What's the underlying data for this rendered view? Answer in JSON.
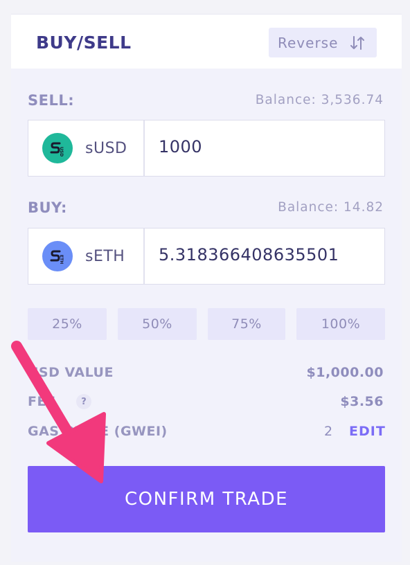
{
  "header": {
    "title": "BUY/SELL",
    "reverse_label": "Reverse"
  },
  "sell": {
    "label": "SELL:",
    "balance": "Balance: 3,536.74",
    "token": "sUSD",
    "token_icon": "susd-coin-icon",
    "amount": "1000"
  },
  "buy": {
    "label": "BUY:",
    "balance": "Balance: 14.82",
    "token": "sETH",
    "token_icon": "seth-coin-icon",
    "amount": "5.318366408635501"
  },
  "percent_buttons": [
    "25%",
    "50%",
    "75%",
    "100%"
  ],
  "info": {
    "usd_value_label": "USD VALUE",
    "usd_value": "$1,000.00",
    "fee_label": "FEE",
    "fee_help": "?",
    "fee_value": "$3.56",
    "gas_label": "GAS PRICE (GWEI)",
    "gas_value": "2",
    "gas_edit": "EDIT"
  },
  "confirm_label": "CONFIRM TRADE",
  "colors": {
    "accent": "#7b5bf5",
    "title": "#3e3a89",
    "susd_coin": "#1fb89a",
    "seth_coin": "#6a8ef7",
    "pointer_arrow": "#f2397c"
  }
}
